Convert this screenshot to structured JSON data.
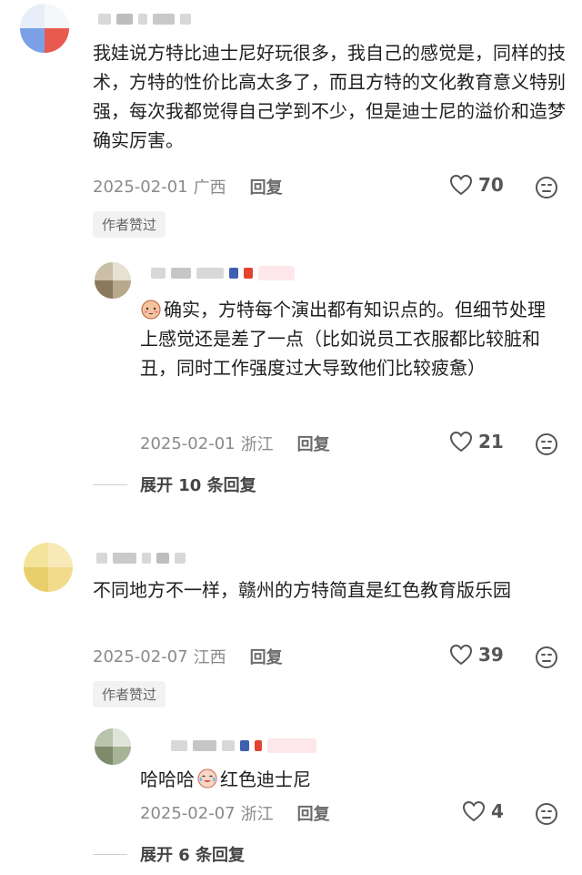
{
  "comments": [
    {
      "text": "我娃说方特比迪士尼好玩很多，我自己的感觉是，同样的技术，方特的性价比高太多了，而且方特的文化教育意义特别强，每次我都觉得自己学到不少，但是迪士尼的溢价和造梦确实厉害。",
      "date": "2025-02-01",
      "location": "广西",
      "reply_label": "回复",
      "likes": "70",
      "author_liked": "作者赞过",
      "reply": {
        "text": "确实，方特每个演出都有知识点的。但细节处理上感觉还是差了一点（比如说员工衣服都比较脏和丑，同时工作强度过大导致他们比较疲惫）",
        "date": "2025-02-01",
        "location": "浙江",
        "reply_label": "回复",
        "likes": "21"
      },
      "expand_label": "展开 10 条回复"
    },
    {
      "text": "不同地方不一样，赣州的方特简直是红色教育版乐园",
      "date": "2025-02-07",
      "location": "江西",
      "reply_label": "回复",
      "likes": "39",
      "author_liked": "作者赞过",
      "reply": {
        "text_before": "哈哈哈",
        "text_after": "红色迪士尼",
        "date": "2025-02-07",
        "location": "浙江",
        "reply_label": "回复",
        "likes": "4"
      },
      "expand_label": "展开 6 条回复"
    }
  ],
  "colors": {
    "text": "#1f1f1f",
    "meta": "#8a8a8a",
    "author_liked_bg": "#f2f2f2",
    "badge_pink": "#fde7ea"
  }
}
